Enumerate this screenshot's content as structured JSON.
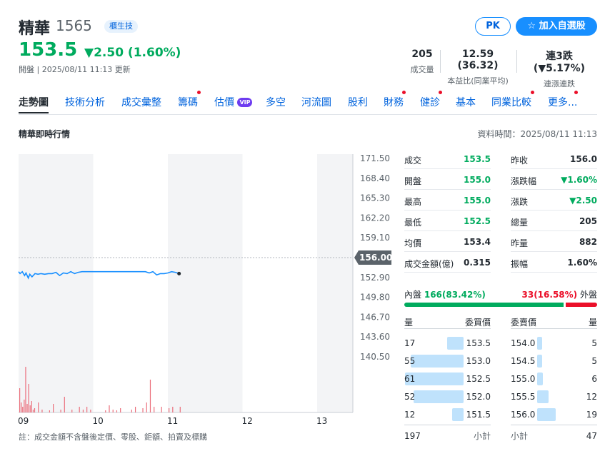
{
  "header": {
    "name": "精華",
    "code": "1565",
    "badge": "櫃生技",
    "price": "153.5",
    "change": "▼2.50 (1.60%)",
    "updated": "開盤 | 2025/08/11 11:13 更新",
    "pk_label": "PK",
    "watch_label": "☆  加入自選股"
  },
  "stats": [
    {
      "value": "205",
      "label": "成交量"
    },
    {
      "value": "12.59 (36.32)",
      "label": "本益比(同業平均)"
    },
    {
      "value": "連3跌 (▼5.17%)",
      "label": "連漲連跌"
    }
  ],
  "tabs": [
    "走勢圖",
    "技術分析",
    "成交彙整",
    "籌碼",
    "估價",
    "多空",
    "河流圖",
    "股利",
    "財務",
    "健診",
    "基本",
    "同業比較",
    "更多..."
  ],
  "vip_label": "VIP",
  "section": {
    "title": "精華即時行情",
    "data_time": "資料時間：2025/08/11 11:13"
  },
  "chart_data": {
    "type": "line",
    "x_ticks": [
      "09",
      "10",
      "11",
      "12",
      "13"
    ],
    "y_ticks": [
      "171.50",
      "168.40",
      "165.30",
      "162.20",
      "159.10",
      "156.00",
      "152.90",
      "149.80",
      "146.70",
      "143.60",
      "140.50"
    ],
    "ylim": [
      140.5,
      171.5
    ],
    "reference_price": 156.0,
    "reference_label": "156.00",
    "price_series": {
      "x": [
        9.0,
        9.02,
        9.05,
        9.08,
        9.1,
        9.13,
        9.15,
        9.18,
        9.22,
        9.26,
        9.3,
        9.35,
        9.4,
        9.45,
        9.5,
        9.55,
        9.6,
        9.65,
        9.7,
        9.75,
        9.8,
        9.85,
        9.9,
        9.95,
        10.0,
        10.2,
        10.4,
        10.6,
        10.7,
        10.75,
        10.8,
        10.85,
        10.9,
        10.95,
        11.0,
        11.05,
        11.1,
        11.15
      ],
      "y": [
        153.8,
        153.5,
        153.8,
        153.2,
        153.6,
        152.8,
        153.4,
        153.0,
        153.5,
        153.4,
        153.5,
        153.4,
        153.5,
        153.5,
        153.7,
        153.2,
        153.6,
        153.5,
        153.8,
        153.5,
        153.7,
        153.8,
        153.8,
        153.8,
        153.8,
        153.8,
        153.8,
        153.8,
        153.8,
        153.6,
        153.8,
        153.3,
        153.5,
        153.5,
        153.6,
        153.8,
        153.7,
        153.5
      ]
    },
    "volume_series": {
      "x": [
        9.0,
        9.02,
        9.04,
        9.06,
        9.08,
        9.1,
        9.12,
        9.14,
        9.16,
        9.18,
        9.2,
        9.25,
        9.3,
        9.4,
        9.45,
        9.55,
        9.6,
        9.7,
        9.8,
        9.85,
        9.9,
        9.95,
        10.15,
        10.2,
        10.25,
        10.3,
        10.35,
        10.5,
        10.55,
        10.65,
        10.7,
        10.75,
        10.8,
        10.9,
        11.0,
        11.05,
        11.15
      ],
      "y": [
        34,
        14,
        8,
        18,
        64,
        12,
        40,
        10,
        16,
        4,
        6,
        14,
        4,
        3,
        12,
        4,
        22,
        4,
        8,
        4,
        8,
        4,
        3,
        10,
        4,
        3,
        6,
        4,
        8,
        6,
        14,
        46,
        8,
        8,
        6,
        8,
        8
      ]
    }
  },
  "quote": {
    "left": [
      {
        "label": "成交",
        "value": "153.5",
        "tone": "green"
      },
      {
        "label": "開盤",
        "value": "155.0",
        "tone": "green"
      },
      {
        "label": "最高",
        "value": "155.0",
        "tone": "green"
      },
      {
        "label": "最低",
        "value": "152.5",
        "tone": "green"
      },
      {
        "label": "均價",
        "value": "153.4",
        "tone": "dark"
      },
      {
        "label": "成交金額(億)",
        "value": "0.315",
        "tone": "dark"
      }
    ],
    "right": [
      {
        "label": "昨收",
        "value": "156.0",
        "tone": "dark"
      },
      {
        "label": "漲跌幅",
        "value": "▼1.60%",
        "tone": "green"
      },
      {
        "label": "漲跌",
        "value": "▼2.50",
        "tone": "green"
      },
      {
        "label": "總量",
        "value": "205",
        "tone": "dark"
      },
      {
        "label": "昨量",
        "value": "882",
        "tone": "dark"
      },
      {
        "label": "振幅",
        "value": "1.60%",
        "tone": "dark"
      }
    ]
  },
  "inout": {
    "inner_label": "內盤",
    "inner_value": "166(83.42%)",
    "inner_fraction": 0.8342,
    "outer_value": "33(16.58%)",
    "outer_label": "外盤"
  },
  "orderbook": {
    "headers": [
      "量",
      "委買價",
      "委賣價",
      "量"
    ],
    "bids": [
      {
        "qty": "17",
        "price": "153.5",
        "qn": 17
      },
      {
        "qty": "55",
        "price": "153.0",
        "qn": 55
      },
      {
        "qty": "61",
        "price": "152.5",
        "qn": 61
      },
      {
        "qty": "52",
        "price": "152.0",
        "qn": 52
      },
      {
        "qty": "12",
        "price": "151.5",
        "qn": 12
      }
    ],
    "asks": [
      {
        "price": "154.0",
        "qty": "5",
        "qn": 5
      },
      {
        "price": "154.5",
        "qty": "5",
        "qn": 5
      },
      {
        "price": "155.0",
        "qty": "6",
        "qn": 6
      },
      {
        "price": "155.5",
        "qty": "12",
        "qn": 12
      },
      {
        "price": "156.0",
        "qty": "19",
        "qn": 19
      }
    ],
    "bid_total": "197",
    "bid_total_label": "小計",
    "ask_total_label": "小計",
    "ask_total": "47"
  },
  "note": "註：成交金額不含盤後定價、零股、鉅額、拍賣及標購",
  "colors": {
    "up": "#eb0f29",
    "down": "#00ab5e",
    "line": "#188fff",
    "accent": "#188fff"
  }
}
